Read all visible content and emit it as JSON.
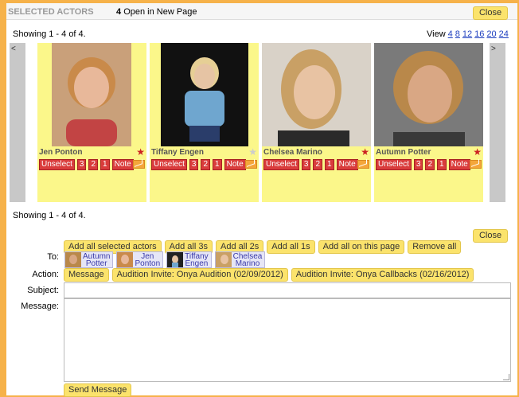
{
  "header": {
    "title": "SELECTED ACTORS",
    "open_count": "4",
    "open_label": "Open in New Page",
    "close_label": "Close"
  },
  "showing_top": "Showing 1 - 4 of 4.",
  "showing_bottom": "Showing 1 - 4 of 4.",
  "view": {
    "label": "View",
    "options": [
      "4",
      "8",
      "12",
      "16",
      "20",
      "24"
    ]
  },
  "nav": {
    "prev": "<",
    "next": ">"
  },
  "actors": [
    {
      "name": "Jen Ponton",
      "starred": true,
      "photo": {
        "bg": "#c9a07a",
        "face": "#e8b89a",
        "hair": "#c98a4a",
        "shirt": "#c24444"
      }
    },
    {
      "name": "Tiffany Engen",
      "starred": false,
      "photo": {
        "bg": "#111111",
        "face": "#e6c4a4",
        "hair": "#e6cf95",
        "shirt": "#6fa6cf"
      }
    },
    {
      "name": "Chelsea Marino",
      "starred": true,
      "photo": {
        "bg": "#d9d2c8",
        "face": "#e8c3a3",
        "hair": "#c9a065",
        "shirt": "#2a2a2a"
      }
    },
    {
      "name": "Autumn Potter",
      "starred": true,
      "photo": {
        "bg": "#7a7a7a",
        "face": "#d9a784",
        "hair": "#b9884a",
        "shirt": "#3a3a3a"
      }
    }
  ],
  "card_buttons": {
    "unselect": "Unselect",
    "rank3": "3",
    "rank2": "2",
    "rank1": "1",
    "note": "Note"
  },
  "close2_label": "Close",
  "add_buttons": [
    "Add all selected actors",
    "Add all 3s",
    "Add all 2s",
    "Add all 1s",
    "Add all on this page",
    "Remove all"
  ],
  "to_label": "To:",
  "recipients": [
    {
      "first": "Autumn",
      "last": "Potter",
      "color": "#b9884a"
    },
    {
      "first": "Jen",
      "last": "Ponton",
      "color": "#c98a4a"
    },
    {
      "first": "Tiffany",
      "last": "Engen",
      "color": "#333333"
    },
    {
      "first": "Chelsea",
      "last": "Marino",
      "color": "#c9a065"
    }
  ],
  "action_label": "Action:",
  "actions": [
    "Message",
    "Audition Invite: Onya Audition (02/09/2012)",
    "Audition Invite: Onya Callbacks (02/16/2012)"
  ],
  "subject_label": "Subject:",
  "subject_value": "",
  "message_label": "Message:",
  "message_value": "",
  "send_label": "Send Message"
}
